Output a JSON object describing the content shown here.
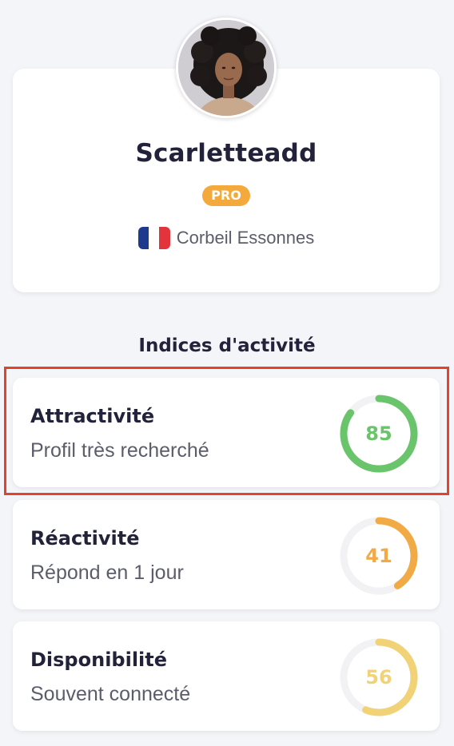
{
  "profile": {
    "username": "Scarletteadd",
    "badge": "PRO",
    "city": "Corbeil Essonnes",
    "country_flag": "france-flag-icon",
    "avatar": "profile-photo"
  },
  "section": {
    "title": "Indices d'activité"
  },
  "metrics": [
    {
      "title": "Attractivité",
      "subtitle": "Profil très recherché",
      "value": 85,
      "score": "85",
      "color": "#6ac46b",
      "highlighted": true
    },
    {
      "title": "Réactivité",
      "subtitle": "Répond en 1 jour",
      "value": 41,
      "score": "41",
      "color": "#f1aa44",
      "highlighted": false
    },
    {
      "title": "Disponibilité",
      "subtitle": "Souvent connecté",
      "value": 56,
      "score": "56",
      "color": "#f2d277",
      "highlighted": false
    }
  ],
  "colors": {
    "background": "#f4f5f9",
    "badge": "#f3a93c",
    "highlight_outline": "#e2432d",
    "ring_track": "#f2f2f4"
  }
}
